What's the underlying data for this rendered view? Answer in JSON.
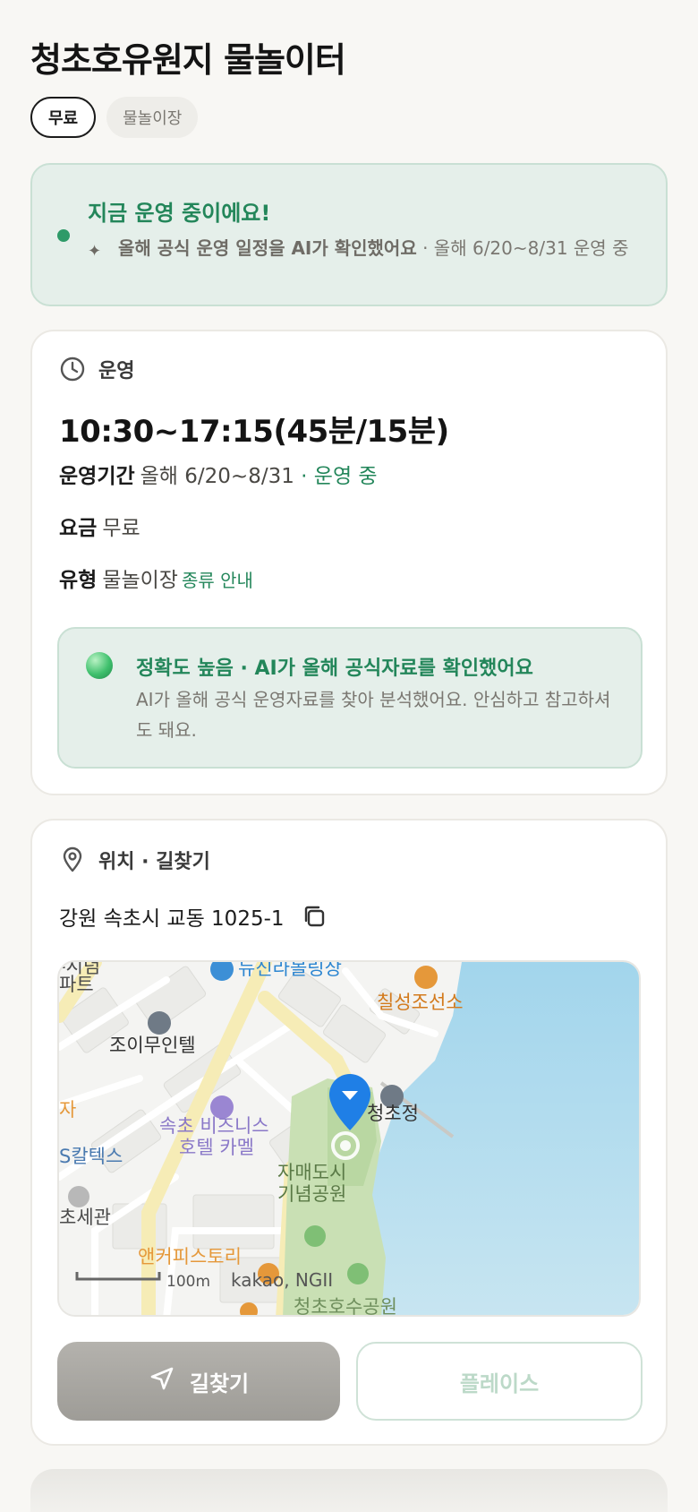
{
  "place": {
    "title": "청초호유원지 물놀이터",
    "tags": [
      "무료",
      "물놀이장"
    ]
  },
  "status": {
    "title": "지금 운영 중이에요!",
    "ai_note": "올해 공식 운영 일정을 AI가 확인했어요",
    "detail": "· 올해 6/20~8/31 운영 중"
  },
  "operation": {
    "section_label": "운영",
    "hours": "10:30~17:15(45분/15분)",
    "period_label": "운영기간",
    "period_value": "올해 6/20~8/31",
    "period_status": "· 운영 중",
    "fee_label": "요금",
    "fee_value": "무료",
    "type_label": "유형",
    "type_value": "물놀이장",
    "type_link": "종류 안내",
    "accuracy_title": "정확도 높음 · AI가 올해 공식자료를 확인했어요",
    "accuracy_desc": "AI가 올해 공식 운영자료를 찾아 분석했어요. 안심하고 참고하셔도 돼요."
  },
  "location": {
    "section_label": "위치 · 길찾기",
    "address": "강원 속초시 교동 1025-1",
    "map": {
      "labels": {
        "top_left": "-시념",
        "apt": "파트",
        "bowling": "뉴신라볼링상",
        "chilseong": "칠성조선소",
        "joy_motel": "조이무인텔",
        "left_ja": "자",
        "hotel_line1": "속초 비즈니스",
        "hotel_line2": "호텔 카멜",
        "cheongchojeong": "청초정",
        "caltex": "S칼텍스",
        "park_line1": "자매도시",
        "park_line2": "기념공원",
        "sechwan": "초세관",
        "anchor": "앤커피스토리",
        "lake_park": "청초호수공원",
        "scale": "100m",
        "attribution": "kakao, NGII"
      }
    },
    "route_button": "길찾기",
    "place_button": "플레이스"
  }
}
